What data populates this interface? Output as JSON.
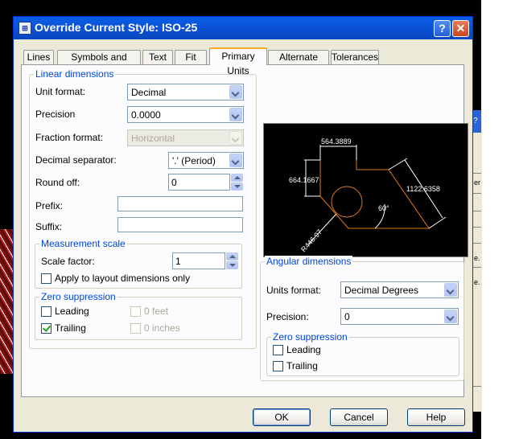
{
  "dialog": {
    "title": "Override Current Style: ISO-25",
    "title_icon": "dimstyle-icon",
    "help_symbol": "?",
    "close_symbol": "✕"
  },
  "tabs": [
    {
      "label": "Lines",
      "active": false
    },
    {
      "label": "Symbols and Arrows",
      "active": false
    },
    {
      "label": "Text",
      "active": false
    },
    {
      "label": "Fit",
      "active": false
    },
    {
      "label": "Primary Units",
      "active": true
    },
    {
      "label": "Alternate Units",
      "active": false
    },
    {
      "label": "Tolerances",
      "active": false
    }
  ],
  "linear": {
    "legend": "Linear dimensions",
    "unit_format_label": "Unit format:",
    "unit_format_value": "Decimal",
    "precision_label": "Precision",
    "precision_value": "0.0000",
    "fraction_format_label": "Fraction format:",
    "fraction_format_value": "Horizontal",
    "decimal_separator_label": "Decimal separator:",
    "decimal_separator_value": "'.' (Period)",
    "round_off_label": "Round off:",
    "round_off_value": "0",
    "prefix_label": "Prefix:",
    "prefix_value": "",
    "suffix_label": "Suffix:",
    "suffix_value": "",
    "measurement": {
      "legend": "Measurement scale",
      "scale_factor_label": "Scale factor:",
      "scale_factor_value": "1",
      "apply_layout_label": "Apply to layout dimensions only",
      "apply_layout_checked": false
    },
    "zero_suppression": {
      "legend": "Zero suppression",
      "leading_label": "Leading",
      "leading_checked": false,
      "trailing_label": "Trailing",
      "trailing_checked": true,
      "feet_label": "0 feet",
      "inches_label": "0 inches"
    }
  },
  "preview": {
    "dim_top": "564.3889",
    "dim_left": "664.1667",
    "dim_right": "1122.6358",
    "dim_angle": "60°",
    "dim_radius": "R446.97"
  },
  "angular": {
    "legend": "Angular dimensions",
    "units_format_label": "Units format:",
    "units_format_value": "Decimal Degrees",
    "precision_label": "Precision:",
    "precision_value": "0",
    "zero_suppression": {
      "legend": "Zero suppression",
      "leading_label": "Leading",
      "leading_checked": false,
      "trailing_label": "Trailing",
      "trailing_checked": false
    }
  },
  "buttons": {
    "ok": "OK",
    "cancel": "Cancel",
    "help": "Help"
  },
  "background_window": {
    "title_fragment": "?",
    "row_fragments": [
      "er",
      "e.",
      "e."
    ]
  }
}
